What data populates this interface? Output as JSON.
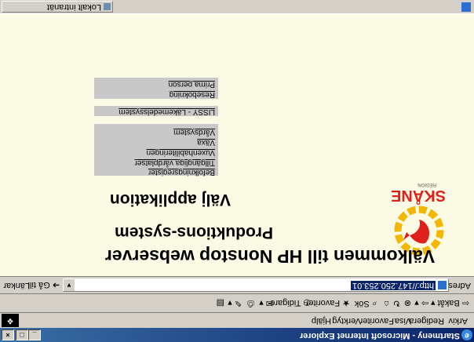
{
  "window": {
    "title": "Startmeny - Microsoft Internet Explorer",
    "buttons": [
      "_",
      "□",
      "×"
    ]
  },
  "menubar": {
    "items": [
      "Arkiv",
      "Redigera",
      "Visa",
      "Favoriter",
      "Verktyg",
      "Hjälp"
    ]
  },
  "toolbar": {
    "back": "Bakåt",
    "search": "Sök",
    "favorites": "Favoriter",
    "history": "Tidigare"
  },
  "addressbar": {
    "label": "Adress",
    "url": "http://147.250.253.01",
    "go": "Gå till",
    "links": "Länkar"
  },
  "page": {
    "logo": {
      "word": "SKÅNE",
      "sub": "REGION"
    },
    "heading": "Välkommen till HP Nonstop webserver",
    "subheading": "Produktions-system",
    "choose": "Välj applikation",
    "groups": [
      {
        "items": [
          "Vårdsystem",
          "Växa",
          "Vuxenhabiliteringen",
          "Tillgängliga vårdplatser",
          "Befolkningsregister"
        ]
      },
      {
        "items": [
          "LISSY - Läkemedelssystem"
        ]
      },
      {
        "items": [
          "Prima person",
          "Resebokning"
        ]
      }
    ]
  },
  "statusbar": {
    "zone": "Lokalt intranät"
  }
}
